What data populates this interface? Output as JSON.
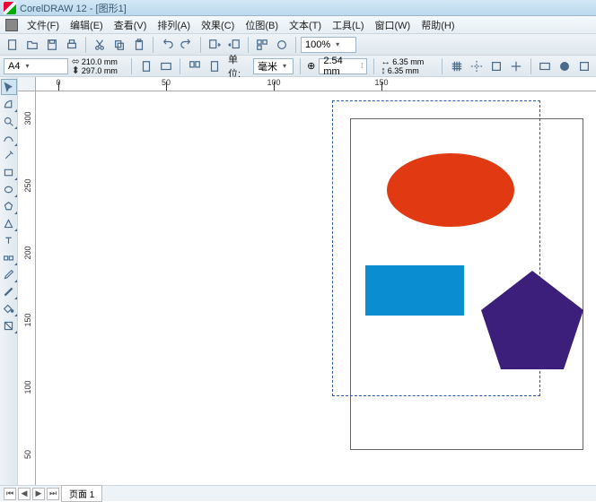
{
  "title": "CorelDRAW 12 - [图形1]",
  "menu": [
    "文件(F)",
    "编辑(E)",
    "查看(V)",
    "排列(A)",
    "效果(C)",
    "位图(B)",
    "文本(T)",
    "工具(L)",
    "窗口(W)",
    "帮助(H)"
  ],
  "toolbar": {
    "zoom": "100%"
  },
  "propbar": {
    "paper": "A4",
    "width": "210.0 mm",
    "height": "297.0 mm",
    "unit_label": "单位:",
    "unit": "毫米",
    "nudge_icon": "⊕",
    "nudge": "2.54 mm",
    "dup_x": "6.35 mm",
    "dup_y": "6.35 mm"
  },
  "ruler_h": [
    "0",
    "50",
    "100",
    "150"
  ],
  "ruler_v": [
    "300",
    "250",
    "200",
    "150",
    "100",
    "50"
  ],
  "tabs": {
    "nav_first": "⏮",
    "nav_prev": "◀",
    "nav_next": "▶",
    "nav_last": "⏭",
    "page": "页面 1"
  },
  "shapes": {
    "ellipse_fill": "#e13a12",
    "rect_fill": "#0b8dd1",
    "pentagon_fill": "#3b1f7a"
  }
}
